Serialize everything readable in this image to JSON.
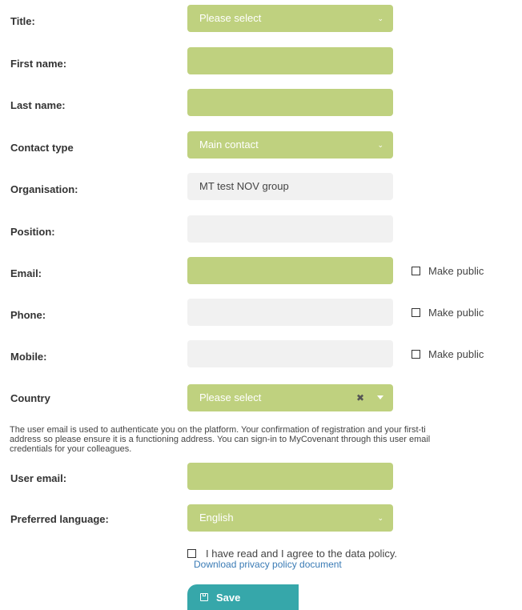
{
  "form": {
    "title": {
      "label": "Title:",
      "value": "Please select"
    },
    "first_name": {
      "label": "First name:",
      "value": ""
    },
    "last_name": {
      "label": "Last name:",
      "value": ""
    },
    "contact_type": {
      "label": "Contact type",
      "value": "Main contact"
    },
    "organisation": {
      "label": "Organisation:",
      "value": "MT test NOV group"
    },
    "position": {
      "label": "Position:",
      "value": ""
    },
    "email": {
      "label": "Email:",
      "value": "",
      "make_public": "Make public"
    },
    "phone": {
      "label": "Phone:",
      "value": "",
      "make_public": "Make public"
    },
    "mobile": {
      "label": "Mobile:",
      "value": "",
      "make_public": "Make public"
    },
    "country": {
      "label": "Country",
      "value": "Please select"
    },
    "info_lines": [
      "The user email is used to authenticate you on the platform. Your confirmation of registration and your first-ti",
      "address so please ensure it is a functioning address. You can sign-in to MyCovenant through this user email",
      "credentials for your colleagues."
    ],
    "user_email": {
      "label": "User email:",
      "value": ""
    },
    "preferred_language": {
      "label": "Preferred language:",
      "value": "English"
    },
    "agree_text": "I have read and I agree to the data policy.",
    "download_link": "Download privacy policy document",
    "save_label": "Save"
  },
  "colors": {
    "required_field": "#bfd17f",
    "optional_field": "#f1f1f1",
    "save_button": "#36a7aa",
    "link": "#3a7bb5"
  }
}
